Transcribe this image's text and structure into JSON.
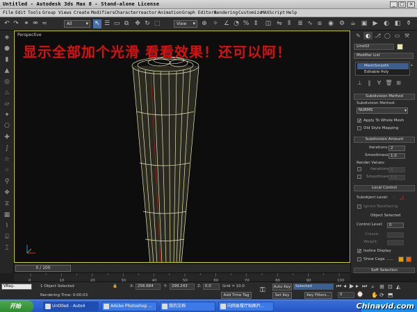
{
  "window": {
    "title": "Untitled - Autodesk 3ds Max 8 - Stand-alone License",
    "min": "_",
    "max": "□",
    "close": "×"
  },
  "menu": [
    "File",
    "Edit",
    "Tools",
    "Group",
    "Views",
    "Create",
    "Modifiers",
    "Character",
    "reactor",
    "Animation",
    "Graph Editors",
    "Rendering",
    "Customize",
    "MAXScript",
    "Help"
  ],
  "toolbar": {
    "selection_filter": "All",
    "ref_coord": "View"
  },
  "viewport": {
    "label": "Perspective",
    "caption": "显示全部加个光滑 看看效果！还可以阿！"
  },
  "command_panel": {
    "object_name": "Line02",
    "modifier_list": "Modifier List",
    "stack": [
      "MeshSmooth",
      "Editable Poly"
    ],
    "subdivision_method": {
      "rollout": "Subdivision Method",
      "label": "Subdivision Method:",
      "method": "NURMS",
      "apply_whole": "Apply To Whole Mesh",
      "old_style": "Old Style Mapping"
    },
    "subdivision_amount": {
      "rollout": "Subdivision Amount",
      "iterations_label": "Iterations:",
      "iterations": "2",
      "smoothness_label": "Smoothness:",
      "smoothness": "1.0",
      "render_values": "Render Values:",
      "r_iterations_label": "Iterations",
      "r_iterations": "0",
      "r_smoothness_label": "Smoothness",
      "r_smoothness": "1.0"
    },
    "local_control": {
      "rollout": "Local Control",
      "subobject_level": "Subobject Level:",
      "ignore_backfacing": "Ignore Backfacing",
      "object_selected": "Object Selected",
      "control_level_label": "Control Level:",
      "control_level": "0",
      "crease_label": "Crease:",
      "weight_label": "Weight:",
      "isoline": "Isoline Display",
      "show_cage": "Show Cage ......"
    },
    "soft_selection": "Soft Selection"
  },
  "timeline": {
    "frame_display": "0 / 100",
    "ticks": [
      "0",
      "10",
      "20",
      "30",
      "40",
      "50",
      "60",
      "70",
      "80",
      "90",
      "100"
    ]
  },
  "status": {
    "script_label": "VRay..",
    "selection": "1 Object Selected",
    "render_time": "Rendering Time: 0:00:03",
    "x_label": "X:",
    "x": "256.684",
    "y_label": "Y:",
    "y": "299.243",
    "z_label": "Z:",
    "z": "0.0",
    "grid": "Grid = 10.0",
    "add_time_tag": "Add Time Tag",
    "auto_key": "Auto Key",
    "auto_key_mode": "Selected",
    "set_key": "Set Key",
    "key_filters": "Key Filters...",
    "frame": "0"
  },
  "taskbar": {
    "start": "开始",
    "tasks": [
      "Untitled - Auto4",
      "Adobe Photoshop ...",
      "我的文档",
      "向网易餐厅贴图片..."
    ],
    "watermark": "Chinavid.com"
  },
  "colors": {
    "caption": "#d81010",
    "viewport_frame": "#d0d000",
    "wire": "#e8e8b8",
    "sel_blue": "#3d5f8f"
  }
}
